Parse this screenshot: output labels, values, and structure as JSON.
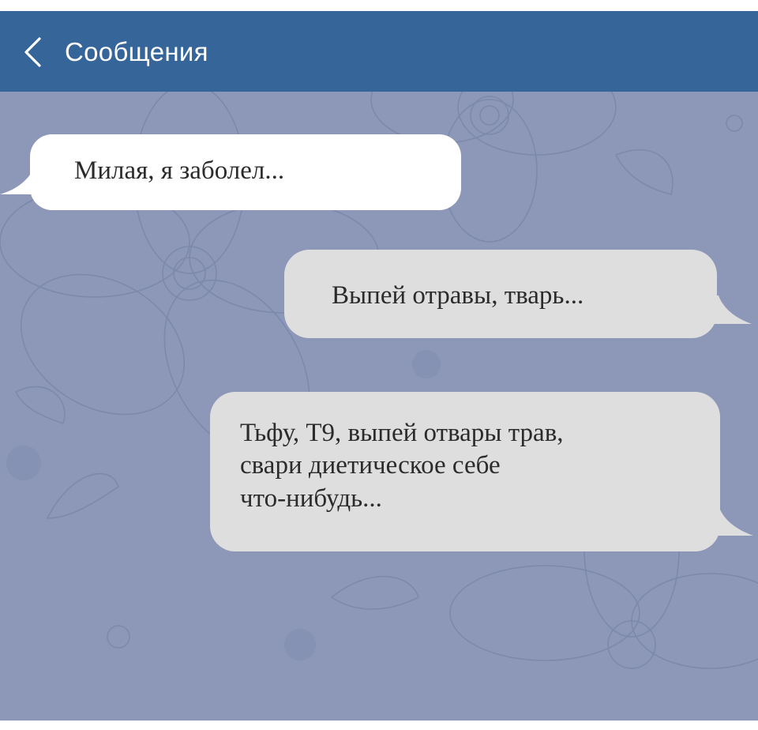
{
  "header": {
    "back_label": "Сообщения",
    "background": "#36659a"
  },
  "chat": {
    "background": "#8d98b8",
    "messages": [
      {
        "direction": "incoming",
        "lines": [
          "Милая, я заболел..."
        ]
      },
      {
        "direction": "outgoing",
        "lines": [
          "Выпей отравы, тварь..."
        ]
      },
      {
        "direction": "outgoing",
        "lines": [
          "Тьфу, Т9, выпей отвары трав,",
          "свари диетическое себе",
          "что-нибудь..."
        ]
      }
    ]
  },
  "colors": {
    "incoming_bubble": "#ffffff",
    "outgoing_bubble": "#dedede",
    "text": "#2b2b2b"
  }
}
